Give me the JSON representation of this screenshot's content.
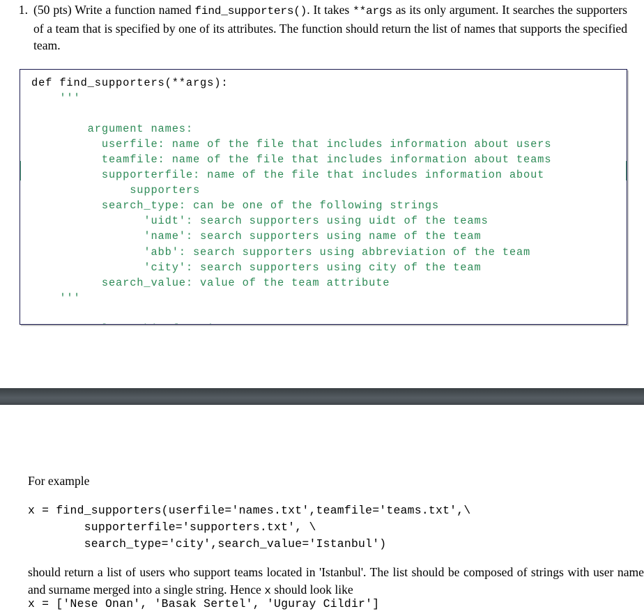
{
  "document": {
    "page_one": {
      "problem": {
        "number": "1.",
        "text_part_1": "(50 pts) Write a function named ",
        "code_1": "find_supporters()",
        "text_part_2": ". It takes ",
        "code_2": "**args",
        "text_part_3": " as its only argument. It searches the supporters of a team that is specified by one of its attributes. The function should return the list of names that supports the specified team."
      },
      "code_box": {
        "lines": [
          {
            "text": "def find_supporters(**args):",
            "style": "kw"
          },
          {
            "text": "    '''",
            "style": "doc"
          },
          {
            "text": "",
            "style": "doc"
          },
          {
            "text": "        argument names:",
            "style": "doc"
          },
          {
            "text": "          userfile: name of the file that includes information about users",
            "style": "doc"
          },
          {
            "text": "          teamfile: name of the file that includes information about teams",
            "style": "doc"
          },
          {
            "text": "          supporterfile: name of the file that includes information about",
            "style": "doc"
          },
          {
            "text": "              supporters",
            "style": "doc"
          },
          {
            "text": "          search_type: can be one of the following strings",
            "style": "doc"
          },
          {
            "text": "                'uidt': search supporters using uidt of the teams",
            "style": "doc"
          },
          {
            "text": "                'name': search supporters using name of the team",
            "style": "doc"
          },
          {
            "text": "                'abb': search supporters using abbreviation of the team",
            "style": "doc"
          },
          {
            "text": "                'city': search supporters using city of the team",
            "style": "doc"
          },
          {
            "text": "          search_value: value of the team attribute",
            "style": "doc"
          },
          {
            "text": "    '''",
            "style": "doc"
          },
          {
            "text": "",
            "style": "doc"
          },
          {
            "text": "    # complete this function",
            "style": "cmt"
          }
        ]
      }
    },
    "page_two": {
      "for_example_label": "For example",
      "example_call": [
        "x = find_supporters(userfile='names.txt',teamfile='teams.txt',\\",
        "        supporterfile='supporters.txt', \\",
        "        search_type='city',search_value='Istanbul')"
      ],
      "explanation_part_1": "should return a list of users who support teams located in 'Istanbul'. The list should be composed of strings with user name and surname merged into a single string. Hence ",
      "explanation_code": "x",
      "explanation_part_2": " should look like",
      "example_result": "x = ['Nese Onan', 'Basak Sertel', 'Uguray Cildir']"
    }
  },
  "colors": {
    "docstring_green": "#2e8b57",
    "code_border": "#1a1a4e",
    "separator_dark": "#3a4044",
    "separator_light": "#555c62",
    "selection_green": "#4f9e76",
    "page_background": "#ffffff",
    "text": "#000000"
  }
}
